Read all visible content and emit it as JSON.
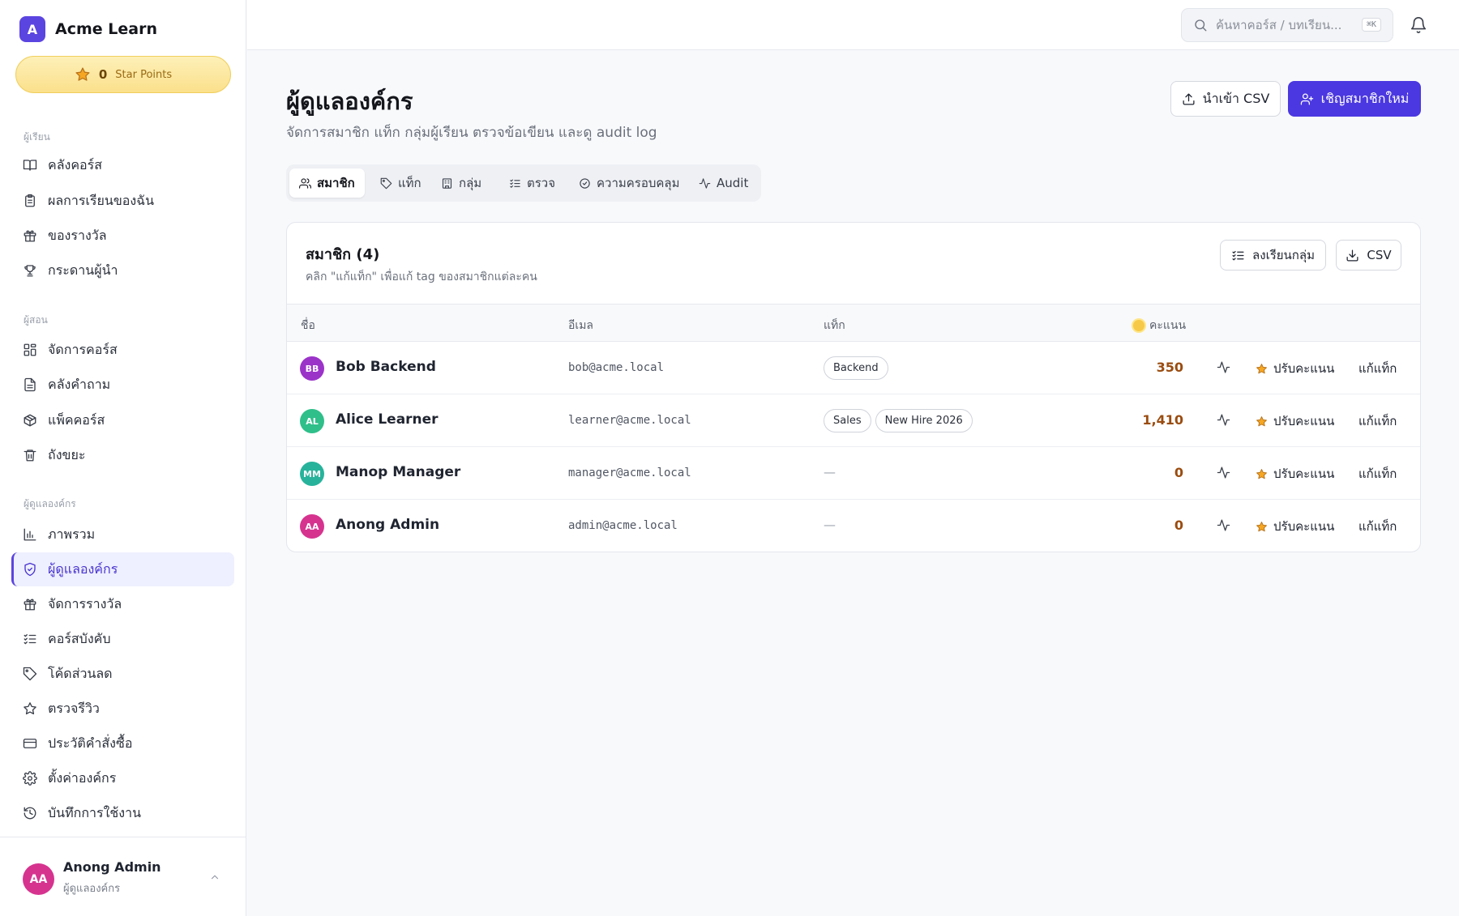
{
  "brand": {
    "logo_letter": "A",
    "name": "Acme Learn"
  },
  "points": {
    "value": "0",
    "label": "Star Points"
  },
  "sidebar": {
    "sections": [
      {
        "label": "ผู้เรียน",
        "items": [
          {
            "label": "คลังคอร์ส",
            "icon": "book-open-icon"
          },
          {
            "label": "ผลการเรียนของฉัน",
            "icon": "clipboard-icon"
          },
          {
            "label": "ของรางวัล",
            "icon": "gift-icon"
          },
          {
            "label": "กระดานผู้นำ",
            "icon": "trophy-icon"
          }
        ]
      },
      {
        "label": "ผู้สอน",
        "items": [
          {
            "label": "จัดการคอร์ส",
            "icon": "layout-grid-icon"
          },
          {
            "label": "คลังคำถาม",
            "icon": "file-text-icon"
          },
          {
            "label": "แพ็คคอร์ส",
            "icon": "package-icon"
          },
          {
            "label": "ถังขยะ",
            "icon": "trash-icon"
          }
        ]
      },
      {
        "label": "ผู้ดูแลองค์กร",
        "items": [
          {
            "label": "ภาพรวม",
            "icon": "bar-chart-icon"
          },
          {
            "label": "ผู้ดูแลองค์กร",
            "icon": "shield-check-icon",
            "active": true
          },
          {
            "label": "จัดการรางวัล",
            "icon": "gift-icon"
          },
          {
            "label": "คอร์สบังคับ",
            "icon": "list-checks-icon"
          },
          {
            "label": "โค้ดส่วนลด",
            "icon": "tag-icon"
          },
          {
            "label": "ตรวจรีวิว",
            "icon": "star-icon"
          },
          {
            "label": "ประวัติคำสั่งซื้อ",
            "icon": "credit-card-icon"
          },
          {
            "label": "ตั้งค่าองค์กร",
            "icon": "settings-icon"
          },
          {
            "label": "บันทึกการใช้งาน",
            "icon": "history-icon"
          }
        ]
      }
    ]
  },
  "user": {
    "initials": "AA",
    "name": "Anong Admin",
    "role": "ผู้ดูแลองค์กร"
  },
  "search": {
    "placeholder": "ค้นหาคอร์ส / บทเรียน...",
    "shortcut": "⌘K"
  },
  "page": {
    "title": "ผู้ดูแลองค์กร",
    "subtitle": "จัดการสมาชิก แท็ก กลุ่มผู้เรียน ตรวจข้อเขียน และดู audit log",
    "import_label": "นำเข้า CSV",
    "invite_label": "เชิญสมาชิกใหม่"
  },
  "tabs": [
    {
      "label": "สมาชิก",
      "icon": "users-icon",
      "active": true
    },
    {
      "label": "แท็ก",
      "icon": "tag-icon"
    },
    {
      "label": "กลุ่ม",
      "icon": "building-icon"
    },
    {
      "label": "ตรวจ",
      "icon": "list-checks-icon"
    },
    {
      "label": "ความครอบคลุม",
      "icon": "check-circle-icon"
    },
    {
      "label": "Audit",
      "icon": "activity-icon"
    }
  ],
  "members_card": {
    "title": "สมาชิก (4)",
    "subtitle": "คลิก \"แก้แท็ก\" เพื่อแก้ tag ของสมาชิกแต่ละคน",
    "enroll_label": "ลงเรียนกลุ่ม",
    "csv_label": "CSV",
    "columns": {
      "name": "ชื่อ",
      "email": "อีเมล",
      "tags": "แท็ก",
      "points": "คะแนน"
    },
    "adjust_label": "ปรับคะแนน",
    "edit_tags_label": "แก้แท็ก",
    "empty_tag": "—",
    "rows": [
      {
        "initials": "BB",
        "avatar_color": "#9b33c9",
        "name": "Bob Backend",
        "email": "bob@acme.local",
        "tags": [
          "Backend"
        ],
        "points": "350"
      },
      {
        "initials": "AL",
        "avatar_color": "#2fbf8a",
        "name": "Alice Learner",
        "email": "learner@acme.local",
        "tags": [
          "Sales",
          "New Hire 2026"
        ],
        "points": "1,410"
      },
      {
        "initials": "MM",
        "avatar_color": "#27b39b",
        "name": "Manop Manager",
        "email": "manager@acme.local",
        "tags": [],
        "points": "0"
      },
      {
        "initials": "AA",
        "avatar_color": "#d6338f",
        "name": "Anong Admin",
        "email": "admin@acme.local",
        "tags": [],
        "points": "0"
      }
    ]
  },
  "colors": {
    "accent": "#4b38e0",
    "points_text": "#9a4c10",
    "active_nav_bg": "#eef0ff"
  }
}
